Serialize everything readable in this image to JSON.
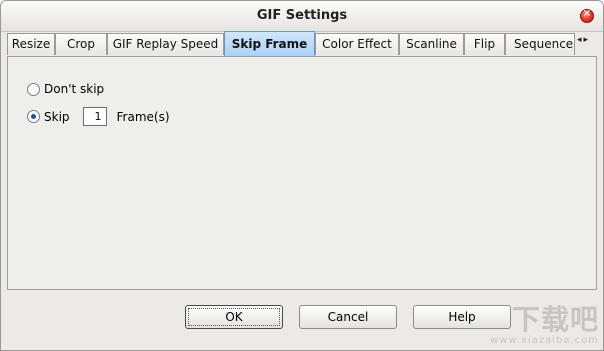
{
  "window": {
    "title": "GIF Settings"
  },
  "tabs": [
    {
      "label": "Resize",
      "active": false
    },
    {
      "label": "Crop",
      "active": false
    },
    {
      "label": "GIF Replay Speed",
      "active": false
    },
    {
      "label": "Skip Frame",
      "active": true
    },
    {
      "label": "Color Effect",
      "active": false
    },
    {
      "label": "Scanline",
      "active": false
    },
    {
      "label": "Flip",
      "active": false
    },
    {
      "label": "Sequence",
      "active": false
    }
  ],
  "tab_scroll": {
    "left_glyph": "◂",
    "right_glyph": "▸"
  },
  "skip_frame": {
    "dont_skip_label": "Don't skip",
    "skip_label": "Skip",
    "selected_option": "skip",
    "frame_count": "1",
    "frame_unit_label": "Frame(s)"
  },
  "buttons": {
    "ok": "OK",
    "cancel": "Cancel",
    "help": "Help"
  },
  "watermark": {
    "main": "下载吧",
    "sub": "www.xiazaiba.com"
  },
  "colors": {
    "active_tab": "#a9d1f5",
    "close_button": "#e8432f"
  }
}
